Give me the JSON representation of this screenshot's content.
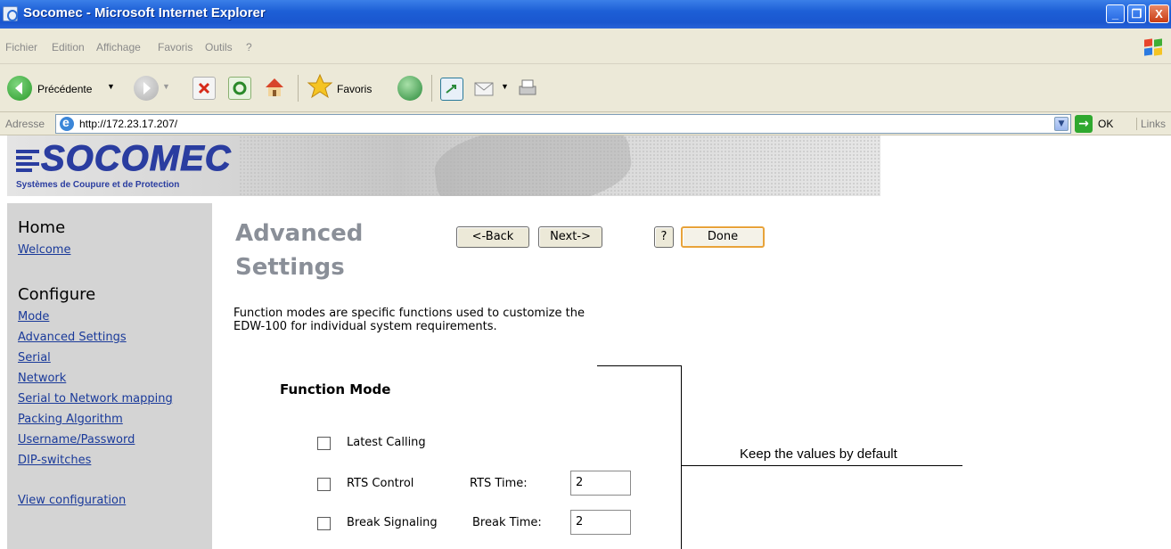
{
  "window": {
    "title": "Socomec - Microsoft Internet Explorer",
    "minimize": "_",
    "restore": "❐",
    "close": "X"
  },
  "menu": [
    "Fichier",
    "Edition",
    "Affichage",
    "Favoris",
    "Outils",
    "?"
  ],
  "toolbar": {
    "back_label": "Précédente",
    "favorites_label": "Favoris"
  },
  "address": {
    "label": "Adresse",
    "url": "http://172.23.17.207/",
    "go_label": "OK",
    "links_label": "Links"
  },
  "banner": {
    "brand": "SOCOMEC",
    "tagline": "Systèmes de Coupure et de Protection"
  },
  "sidebar": {
    "home_heading": "Home",
    "home_links": [
      "Welcome"
    ],
    "configure_heading": "Configure",
    "configure_links": [
      "Mode",
      "Advanced Settings",
      "Serial",
      "Network",
      "Serial to Network mapping",
      "Packing Algorithm",
      "Username/Password",
      "DIP-switches"
    ],
    "view_configuration": "View configuration"
  },
  "main": {
    "title_line1": "Advanced",
    "title_line2": "Settings",
    "back_button": "<-Back",
    "next_button": "Next->",
    "help_button": "?",
    "done_button": "Done",
    "intro_line1": "Function modes are specific functions used to customize the",
    "intro_line2": "EDW-100 for individual system requirements.",
    "section_title": "Function Mode",
    "options": [
      {
        "label": "Latest Calling",
        "checked": false
      },
      {
        "label": "RTS Control",
        "checked": false,
        "time_label": "RTS Time:",
        "time_value": "2"
      },
      {
        "label": "Break Signaling",
        "checked": false,
        "time_label": "Break Time:",
        "time_value": "2"
      }
    ]
  },
  "annotation": {
    "text": "Keep the values by default"
  }
}
